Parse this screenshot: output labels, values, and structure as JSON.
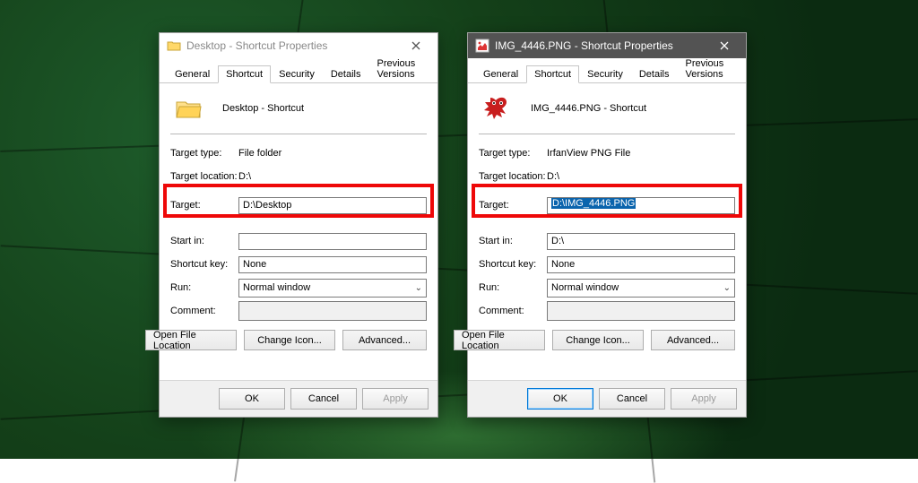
{
  "tabs": [
    "General",
    "Shortcut",
    "Security",
    "Details",
    "Previous Versions"
  ],
  "labels": {
    "target_type": "Target type:",
    "target_location": "Target location:",
    "target": "Target:",
    "start_in": "Start in:",
    "shortcut_key": "Shortcut key:",
    "run": "Run:",
    "comment": "Comment:",
    "open_file_location": "Open File Location",
    "change_icon": "Change Icon...",
    "advanced": "Advanced...",
    "ok": "OK",
    "cancel": "Cancel",
    "apply": "Apply"
  },
  "left": {
    "title": "Desktop - Shortcut Properties",
    "header_name": "Desktop - Shortcut",
    "target_type": "File folder",
    "target_location": "D:\\",
    "target": "D:\\Desktop",
    "start_in": "",
    "shortcut_key": "None",
    "run": "Normal window",
    "comment": ""
  },
  "right": {
    "title": "IMG_4446.PNG - Shortcut Properties",
    "header_name": "IMG_4446.PNG - Shortcut",
    "target_type": "IrfanView PNG File",
    "target_location": "D:\\",
    "target": "D:\\IMG_4446.PNG",
    "start_in": "D:\\",
    "shortcut_key": "None",
    "run": "Normal window",
    "comment": ""
  }
}
